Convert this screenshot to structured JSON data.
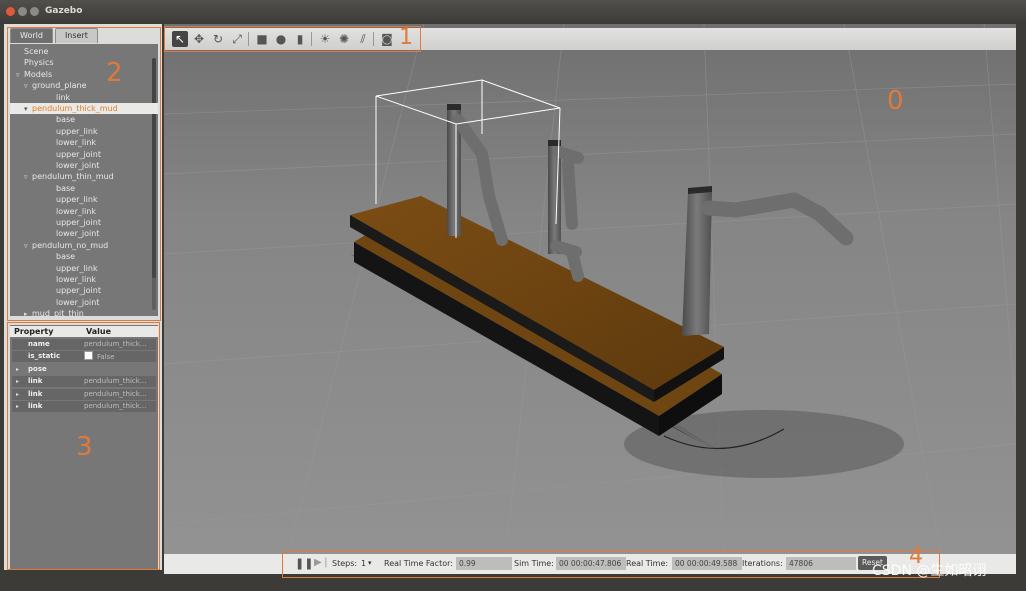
{
  "window": {
    "title": "Gazebo"
  },
  "left_panel": {
    "tabs": [
      {
        "label": "World",
        "active": true
      },
      {
        "label": "Insert",
        "active": false
      }
    ],
    "tree": [
      {
        "label": "Scene",
        "depth": 1,
        "arrow": ""
      },
      {
        "label": "Physics",
        "depth": 1,
        "arrow": ""
      },
      {
        "label": "Models",
        "depth": 1,
        "arrow": "▿"
      },
      {
        "label": "ground_plane",
        "depth": 2,
        "arrow": "▿"
      },
      {
        "label": "link",
        "depth": 3,
        "arrow": ""
      },
      {
        "label": "pendulum_thick_mud",
        "depth": 2,
        "arrow": "▾",
        "selected": true
      },
      {
        "label": "base",
        "depth": 3,
        "arrow": ""
      },
      {
        "label": "upper_link",
        "depth": 3,
        "arrow": ""
      },
      {
        "label": "lower_link",
        "depth": 3,
        "arrow": ""
      },
      {
        "label": "upper_joint",
        "depth": 3,
        "arrow": ""
      },
      {
        "label": "lower_joint",
        "depth": 3,
        "arrow": ""
      },
      {
        "label": "pendulum_thin_mud",
        "depth": 2,
        "arrow": "▿"
      },
      {
        "label": "base",
        "depth": 3,
        "arrow": ""
      },
      {
        "label": "upper_link",
        "depth": 3,
        "arrow": ""
      },
      {
        "label": "lower_link",
        "depth": 3,
        "arrow": ""
      },
      {
        "label": "upper_joint",
        "depth": 3,
        "arrow": ""
      },
      {
        "label": "lower_joint",
        "depth": 3,
        "arrow": ""
      },
      {
        "label": "pendulum_no_mud",
        "depth": 2,
        "arrow": "▿"
      },
      {
        "label": "base",
        "depth": 3,
        "arrow": ""
      },
      {
        "label": "upper_link",
        "depth": 3,
        "arrow": ""
      },
      {
        "label": "lower_link",
        "depth": 3,
        "arrow": ""
      },
      {
        "label": "upper_joint",
        "depth": 3,
        "arrow": ""
      },
      {
        "label": "lower_joint",
        "depth": 3,
        "arrow": ""
      },
      {
        "label": "mud_pit_thin",
        "depth": 2,
        "arrow": "▸"
      }
    ]
  },
  "properties": {
    "header_property": "Property",
    "header_value": "Value",
    "rows": [
      {
        "name": "name",
        "value": "pendulum_thick...",
        "arrow": "",
        "dark": true
      },
      {
        "name": "is_static",
        "value": "False",
        "arrow": "",
        "dark": true,
        "checkbox": true
      },
      {
        "name": "pose",
        "value": "",
        "arrow": "▸",
        "dark": false
      },
      {
        "name": "link",
        "value": "pendulum_thick...",
        "arrow": "▸",
        "dark": true
      },
      {
        "name": "link",
        "value": "pendulum_thick...",
        "arrow": "▸",
        "dark": true
      },
      {
        "name": "link",
        "value": "pendulum_thick...",
        "arrow": "▸",
        "dark": true
      }
    ]
  },
  "toolbar": {
    "tools": [
      {
        "name": "select-arrow-icon",
        "glyph": "↖",
        "active": true
      },
      {
        "name": "translate-icon",
        "glyph": "✥"
      },
      {
        "name": "rotate-icon",
        "glyph": "↻"
      },
      {
        "name": "scale-icon",
        "glyph": "⤢"
      },
      {
        "name": "box-icon",
        "glyph": "■"
      },
      {
        "name": "sphere-icon",
        "glyph": "●"
      },
      {
        "name": "cylinder-icon",
        "glyph": "▮"
      },
      {
        "name": "point-light-icon",
        "glyph": "☀"
      },
      {
        "name": "spot-light-icon",
        "glyph": "✺"
      },
      {
        "name": "directional-light-icon",
        "glyph": "⫽"
      },
      {
        "name": "screenshot-camera-icon",
        "glyph": "◙"
      }
    ]
  },
  "status": {
    "steps_label": "Steps:",
    "steps_value": "1",
    "rtf_label": "Real Time Factor:",
    "rtf_value": "0.99",
    "sim_time_label": "Sim Time:",
    "sim_time_value": "00 00:00:47.806",
    "real_time_label": "Real Time:",
    "real_time_value": "00 00:00:49.588",
    "iterations_label": "Iterations:",
    "iterations_value": "47806",
    "reset_label": "Reset"
  },
  "annotations": [
    "0",
    "1",
    "2",
    "3",
    "4"
  ],
  "watermark": "CSDN @生如昭诩",
  "colors": {
    "accent": "#e07a3b",
    "selected_text": "#e67e22",
    "wood": "#7a4a12",
    "ground": "#8a8a8a"
  }
}
